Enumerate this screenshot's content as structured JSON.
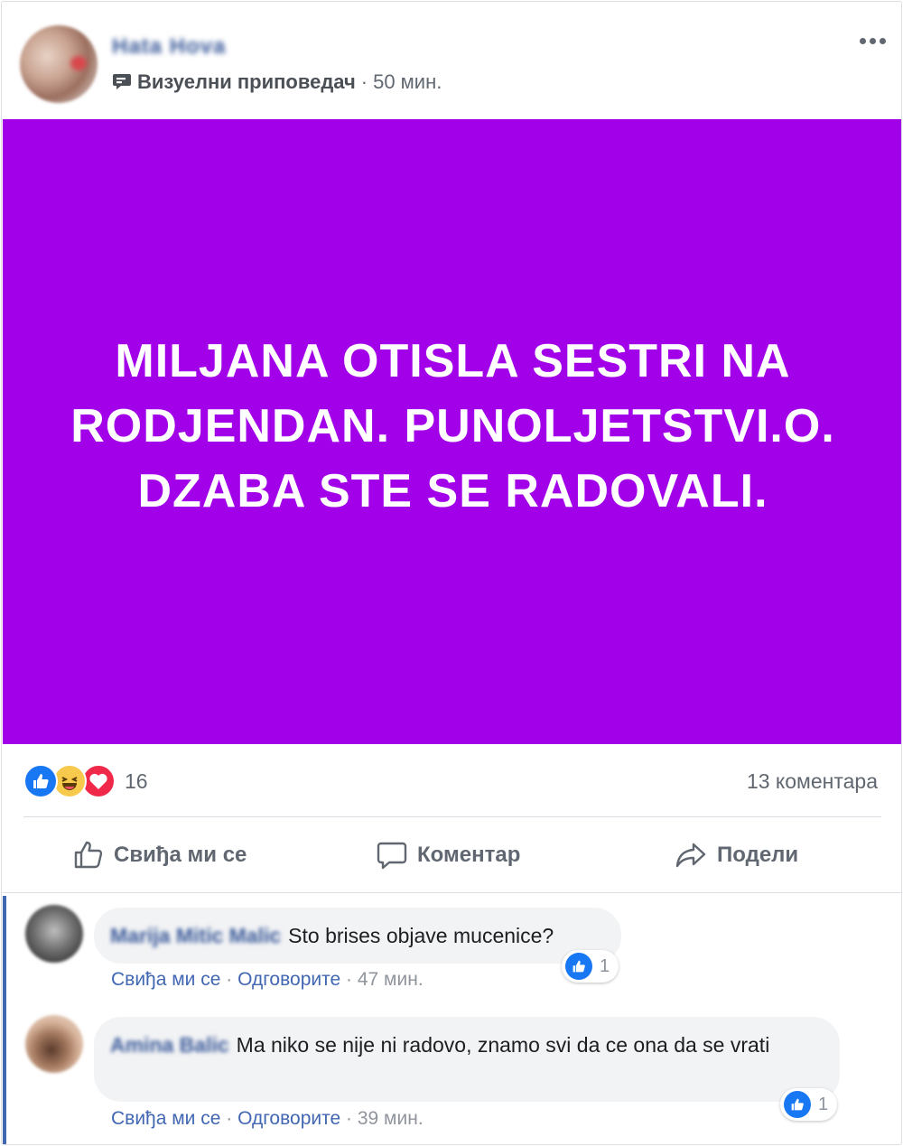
{
  "header": {
    "author_name": "Hata Hova",
    "badge": "Визуелни приповедач",
    "separator": "·",
    "time": "50 мин."
  },
  "post": {
    "text": "MILJANA OTISLA SESTRI NA RODJENDAN. PUNOLJETSTVI.O. DZABA STE SE RADOVALI.",
    "background_color": "#a100e8"
  },
  "reactions": {
    "icons": [
      "like-icon",
      "haha-icon",
      "love-icon"
    ],
    "count": "16",
    "comments_count": "13 коментара"
  },
  "actions": {
    "like": "Свиђа ми се",
    "comment": "Коментар",
    "share": "Подели"
  },
  "comments": [
    {
      "author": "Marija Mitic Malic",
      "text": "Sto brises objave mucenice?",
      "reaction_count": "1",
      "like_label": "Свиђа ми се",
      "reply_label": "Одговорите",
      "time": "47 мин."
    },
    {
      "author": "Amina Balic",
      "text": "Ma niko se nije ni radovo, znamo svi da ce ona da se vrati",
      "reaction_count": "1",
      "like_label": "Свиђа ми се",
      "reply_label": "Одговорите",
      "time": "39 мин."
    }
  ],
  "colors": {
    "link": "#385898",
    "like_blue": "#1877f2",
    "love_red": "#f02849",
    "haha_yellow": "#f7c94c"
  }
}
